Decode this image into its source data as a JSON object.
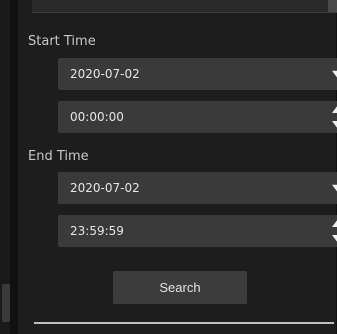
{
  "form": {
    "start_time_label": "Start Time",
    "start_date_value": "2020-07-02",
    "start_time_value": "00:00:00",
    "end_time_label": "End Time",
    "end_date_value": "2020-07-02",
    "end_time_value": "23:59:59",
    "search_label": "Search"
  },
  "icons": {
    "dropdown": "chevron-down-icon",
    "spinner_up": "spinner-up-icon",
    "spinner_down": "spinner-down-icon"
  },
  "colors": {
    "background": "#1d1d1d",
    "field": "#3a3a3a",
    "text": "#e6e6e6",
    "label": "#c8c8c8"
  }
}
